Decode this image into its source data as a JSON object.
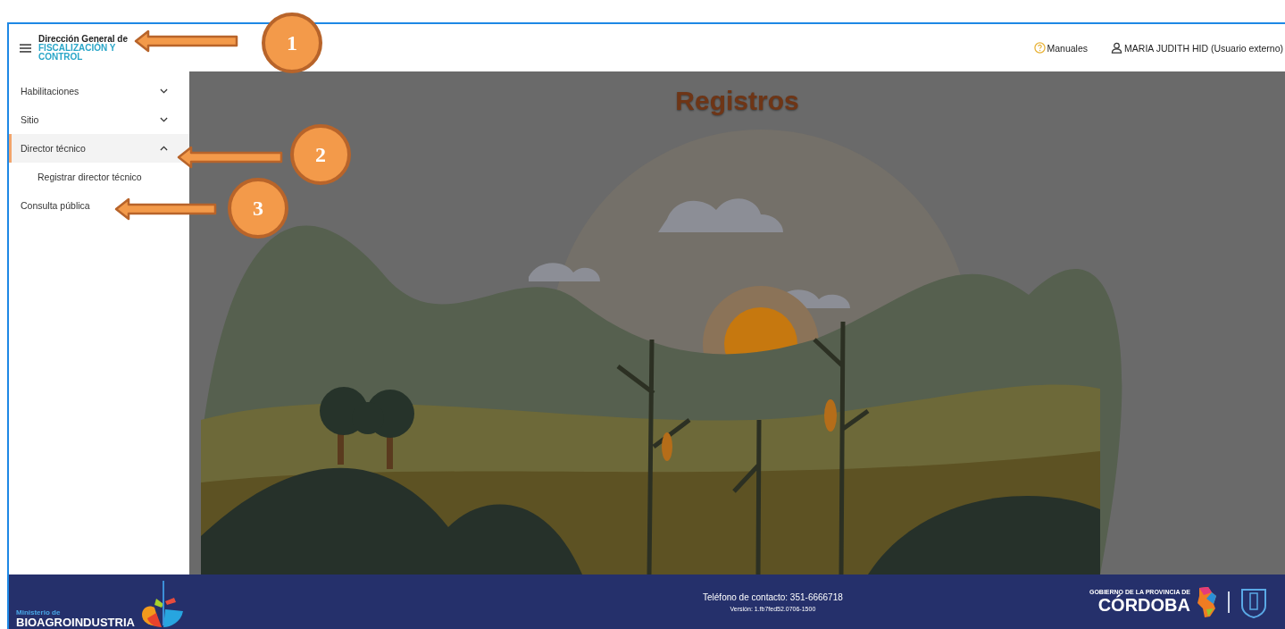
{
  "header": {
    "brand_line1": "Dirección General de",
    "brand_line2": "FISCALIZACIÓN Y",
    "brand_line3": "CONTROL",
    "links": [
      {
        "kind": "help",
        "label": "Manuales"
      },
      {
        "kind": "user",
        "label": "MARIA JUDITH HID (Usuario externo)"
      }
    ]
  },
  "sidebar": {
    "items": [
      {
        "kind": "group",
        "label": "Habilitaciones",
        "expanded": false,
        "selected": false
      },
      {
        "kind": "group",
        "label": "Sitio",
        "expanded": false,
        "selected": false
      },
      {
        "kind": "group",
        "label": "Director técnico",
        "expanded": true,
        "selected": true,
        "children": [
          {
            "label": "Registrar director técnico"
          }
        ]
      },
      {
        "kind": "link",
        "label": "Consulta pública",
        "expanded": false,
        "selected": false
      }
    ]
  },
  "main": {
    "title": "Registros"
  },
  "footer": {
    "ministry_small": "Ministerio de",
    "ministry_name": "BIOAGROINDUSTRIA",
    "phone": "Teléfono de contacto: 351-6666718",
    "version": "Versión: 1.fb7fed52.0706-1500",
    "province_small": "GOBIERNO DE LA PROVINCIA DE",
    "province_name": "CÓRDOBA"
  },
  "annotations": [
    {
      "number": "1"
    },
    {
      "number": "2"
    },
    {
      "number": "3"
    }
  ]
}
